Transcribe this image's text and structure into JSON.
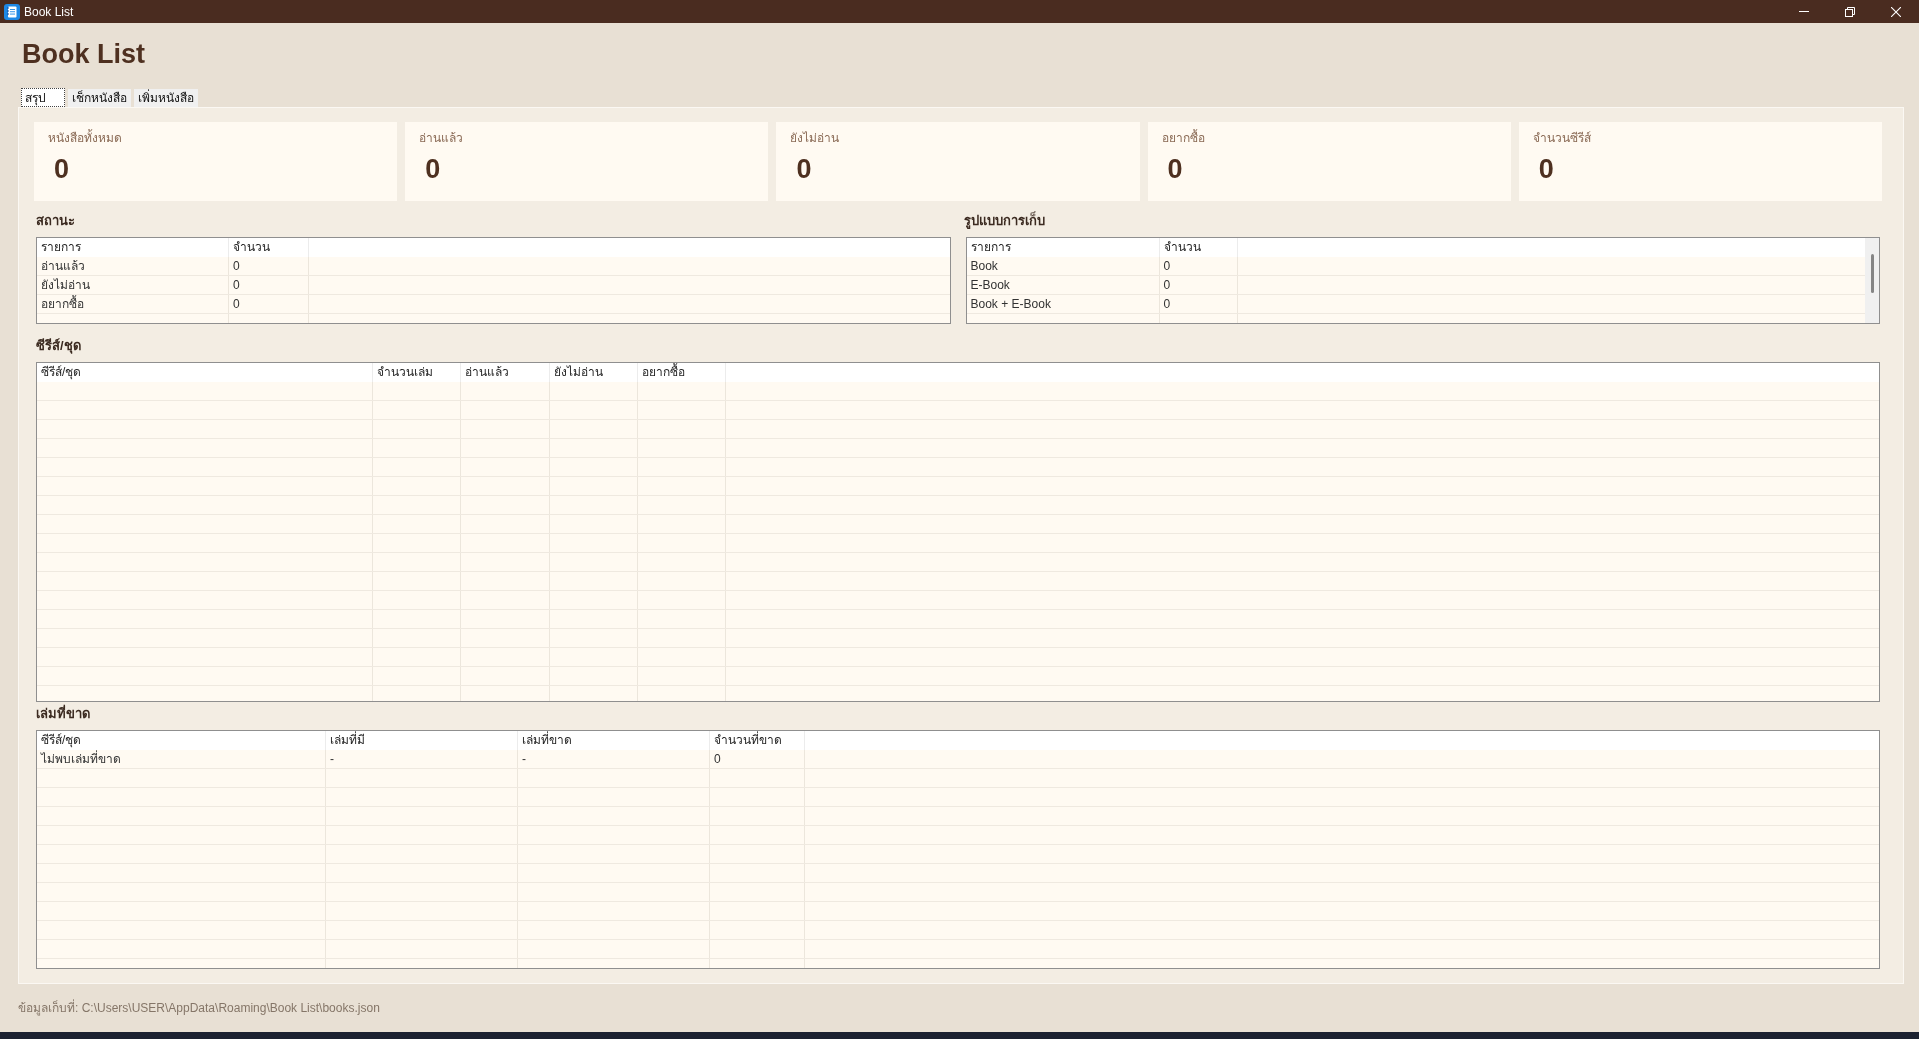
{
  "window": {
    "title": "Book List"
  },
  "heading": "Book List",
  "tabs": [
    {
      "label": "สรุป",
      "selected": true
    },
    {
      "label": "เช็กหนังสือ",
      "selected": false
    },
    {
      "label": "เพิ่มหนังสือ",
      "selected": false
    }
  ],
  "stats": [
    {
      "label": "หนังสือทั้งหมด",
      "value": "0"
    },
    {
      "label": "อ่านแล้ว",
      "value": "0"
    },
    {
      "label": "ยังไม่อ่าน",
      "value": "0"
    },
    {
      "label": "อยากซื้อ",
      "value": "0"
    },
    {
      "label": "จำนวนซีรีส์",
      "value": "0"
    }
  ],
  "status_table": {
    "title": "สถานะ",
    "columns": [
      "รายการ",
      "จำนวน"
    ],
    "rows": [
      [
        "อ่านแล้ว",
        "0"
      ],
      [
        "ยังไม่อ่าน",
        "0"
      ],
      [
        "อยากซื้อ",
        "0"
      ]
    ]
  },
  "format_table": {
    "title": "รูปแบบการเก็บ",
    "columns": [
      "รายการ",
      "จำนวน"
    ],
    "rows": [
      [
        "Book",
        "0"
      ],
      [
        "E-Book",
        "0"
      ],
      [
        "Book + E-Book",
        "0"
      ]
    ]
  },
  "series_table": {
    "title": "ซีรีส์/ชุด",
    "columns": [
      "ซีรีส์/ชุด",
      "จำนวนเล่ม",
      "อ่านแล้ว",
      "ยังไม่อ่าน",
      "อยากซื้อ"
    ]
  },
  "missing_table": {
    "title": "เล่มที่ขาด",
    "columns": [
      "ซีรีส์/ชุด",
      "เล่มที่มี",
      "เล่มที่ขาด",
      "จำนวนที่ขาด"
    ],
    "rows": [
      [
        "ไม่พบเล่มที่ขาด",
        "-",
        "-",
        "0"
      ]
    ]
  },
  "status_bar": {
    "text": "ข้อมูลเก็บที่: C:\\Users\\USER\\AppData\\Roaming\\Book List\\books.json"
  }
}
